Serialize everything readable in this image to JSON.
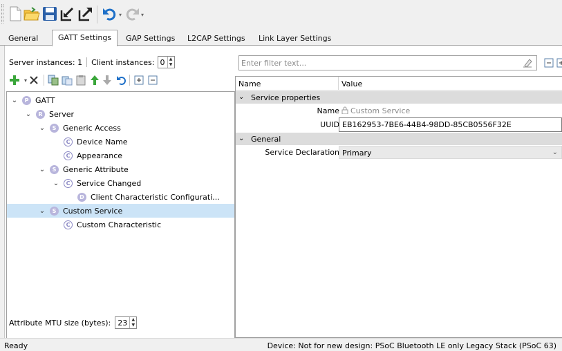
{
  "toolbar": {
    "icons": [
      "new-document-icon",
      "open-folder-icon",
      "save-icon",
      "import-icon",
      "export-icon",
      "undo-icon",
      "redo-icon"
    ]
  },
  "tabs": [
    {
      "label": "General",
      "active": false
    },
    {
      "label": "GATT Settings",
      "active": true
    },
    {
      "label": "GAP Settings",
      "active": false
    },
    {
      "label": "L2CAP Settings",
      "active": false
    },
    {
      "label": "Link Layer Settings",
      "active": false
    }
  ],
  "left": {
    "server_instances": "Server instances: 1",
    "client_instances_label": "Client instances:",
    "client_instances_value": "0",
    "tree_toolbar_icons": [
      "add-icon",
      "delete-icon",
      "copy-icon",
      "paste-icon",
      "clipboard-icon",
      "move-up-icon",
      "move-down-icon",
      "undo-icon",
      "expand-all-icon",
      "collapse-all-icon"
    ],
    "tree": [
      {
        "badge": "P",
        "label": "GATT"
      },
      {
        "badge": "R",
        "label": "Server"
      },
      {
        "badge": "S",
        "label": "Generic Access"
      },
      {
        "badge": "C",
        "label": "Device Name"
      },
      {
        "badge": "C",
        "label": "Appearance"
      },
      {
        "badge": "S",
        "label": "Generic Attribute"
      },
      {
        "badge": "C",
        "label": "Service Changed"
      },
      {
        "badge": "D",
        "label": "Client Characteristic Configurati..."
      },
      {
        "badge": "S",
        "label": "Custom Service",
        "selected": true
      },
      {
        "badge": "C",
        "label": "Custom Characteristic"
      }
    ],
    "mtu_label": "Attribute MTU size (bytes):",
    "mtu_value": "23"
  },
  "right": {
    "filter_placeholder": "Enter filter text...",
    "col_name": "Name",
    "col_value": "Value",
    "cat_service": "Service properties",
    "row_name_label": "Name",
    "row_name_value": "Custom Service",
    "row_uuid_label": "UUID",
    "row_uuid_value": "EB162953-7BE6-44B4-98DD-85CB0556F32E",
    "cat_general": "General",
    "row_decl_label": "Service Declaration",
    "row_decl_value": "Primary"
  },
  "status": {
    "left": "Ready",
    "right": "Device: Not for new design: PSoC Bluetooth LE only Legacy Stack (PSoC 63)"
  },
  "colors": {
    "selection": "#cce4f7",
    "badge": "#b8b5dc",
    "category_bg": "#dcdcdc"
  }
}
